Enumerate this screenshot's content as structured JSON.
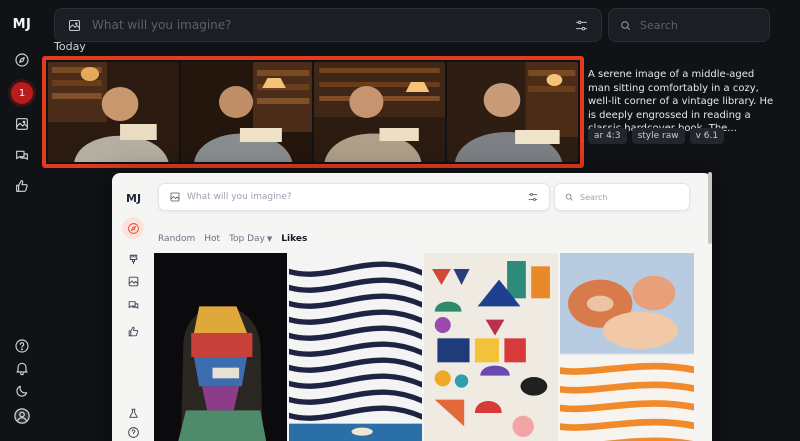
{
  "app": {
    "logo": "MJ"
  },
  "prompt": {
    "placeholder": "What will you imagine?"
  },
  "search": {
    "placeholder": "Search"
  },
  "notification": {
    "count": "1"
  },
  "section": {
    "title": "Today"
  },
  "job": {
    "description": "A serene image of a middle-aged man sitting comfortably in a cozy, well-lit corner of a vintage library. He is deeply engrossed in reading a classic hardcover book. The...",
    "tags": [
      "ar 4:3",
      "style raw",
      "v 6.1"
    ]
  },
  "overlay": {
    "logo": "MJ",
    "prompt_placeholder": "What will you imagine?",
    "search_placeholder": "Search",
    "tabs": [
      "Random",
      "Hot",
      "Top Day",
      "Likes"
    ]
  },
  "colors": {
    "highlight": "#e23b1e",
    "accent": "#dc4a2c",
    "background": "#101216"
  }
}
